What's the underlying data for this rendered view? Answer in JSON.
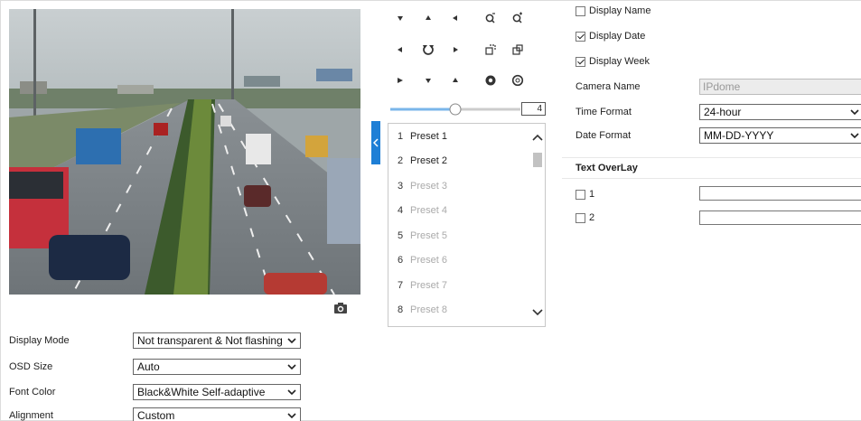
{
  "ptz": {
    "speed": "4",
    "speed_level": 0.5,
    "buttons": [
      "pan-up-left",
      "pan-up",
      "pan-up-right",
      "zoom-in",
      "zoom-out",
      "pan-left",
      "auto-rotate",
      "pan-right",
      "focus-near",
      "focus-far",
      "pan-down-left",
      "pan-down",
      "pan-down-right",
      "iris-open",
      "iris-close"
    ]
  },
  "presets": [
    {
      "num": "1",
      "name": "Preset 1",
      "set": true
    },
    {
      "num": "2",
      "name": "Preset 2",
      "set": true
    },
    {
      "num": "3",
      "name": "Preset 3",
      "set": false
    },
    {
      "num": "4",
      "name": "Preset 4",
      "set": false
    },
    {
      "num": "5",
      "name": "Preset 5",
      "set": false
    },
    {
      "num": "6",
      "name": "Preset 6",
      "set": false
    },
    {
      "num": "7",
      "name": "Preset 7",
      "set": false
    },
    {
      "num": "8",
      "name": "Preset 8",
      "set": false
    }
  ],
  "osd": {
    "display_mode_label": "Display Mode",
    "display_mode_value": "Not transparent & Not flashing",
    "osd_size_label": "OSD Size",
    "osd_size_value": "Auto",
    "font_color_label": "Font Color",
    "font_color_value": "Black&White Self-adaptive",
    "alignment_label": "Alignment",
    "alignment_value": "Custom"
  },
  "display": {
    "display_name_label": "Display Name",
    "display_name_checked": false,
    "display_date_label": "Display Date",
    "display_date_checked": true,
    "display_week_label": "Display Week",
    "display_week_checked": true,
    "camera_name_label": "Camera Name",
    "camera_name_value": "IPdome",
    "time_format_label": "Time Format",
    "time_format_value": "24-hour",
    "date_format_label": "Date Format",
    "date_format_value": "MM-DD-YYYY"
  },
  "text_overlay": {
    "title": "Text OverLay",
    "items": [
      {
        "label": "1",
        "checked": false,
        "value": ""
      },
      {
        "label": "2",
        "checked": false,
        "value": ""
      }
    ]
  },
  "colors": {
    "accent": "#1e7fd6",
    "border": "#c8c8c8"
  }
}
